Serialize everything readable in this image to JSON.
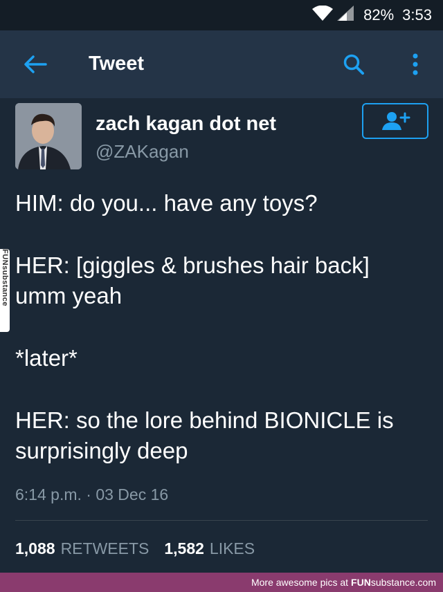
{
  "status_bar": {
    "battery": "82%",
    "time": "3:53"
  },
  "app_bar": {
    "title": "Tweet"
  },
  "tweet": {
    "author": {
      "display_name": "zach kagan dot net",
      "handle": "@ZAKagan"
    },
    "lines": [
      "HIM: do you... have any toys?",
      "HER: [giggles & brushes hair back] umm yeah",
      "*later*",
      "HER: so the lore behind BIONICLE is surprisingly deep"
    ],
    "timestamp": "6:14 p.m. · 03 Dec 16",
    "stats": {
      "retweets_count": "1,088",
      "retweets_label": "RETWEETS",
      "likes_count": "1,582",
      "likes_label": "LIKES"
    }
  },
  "footer": {
    "text": "More awesome pics at",
    "brand": "FUN",
    "brand2": "substance.com"
  },
  "watermark": {
    "text": "FUNsubstance"
  },
  "colors": {
    "background": "#1b2836",
    "app_bar": "#243447",
    "accent": "#1da1f2",
    "secondary_text": "#8899a6",
    "footer": "#8a3b6e"
  }
}
